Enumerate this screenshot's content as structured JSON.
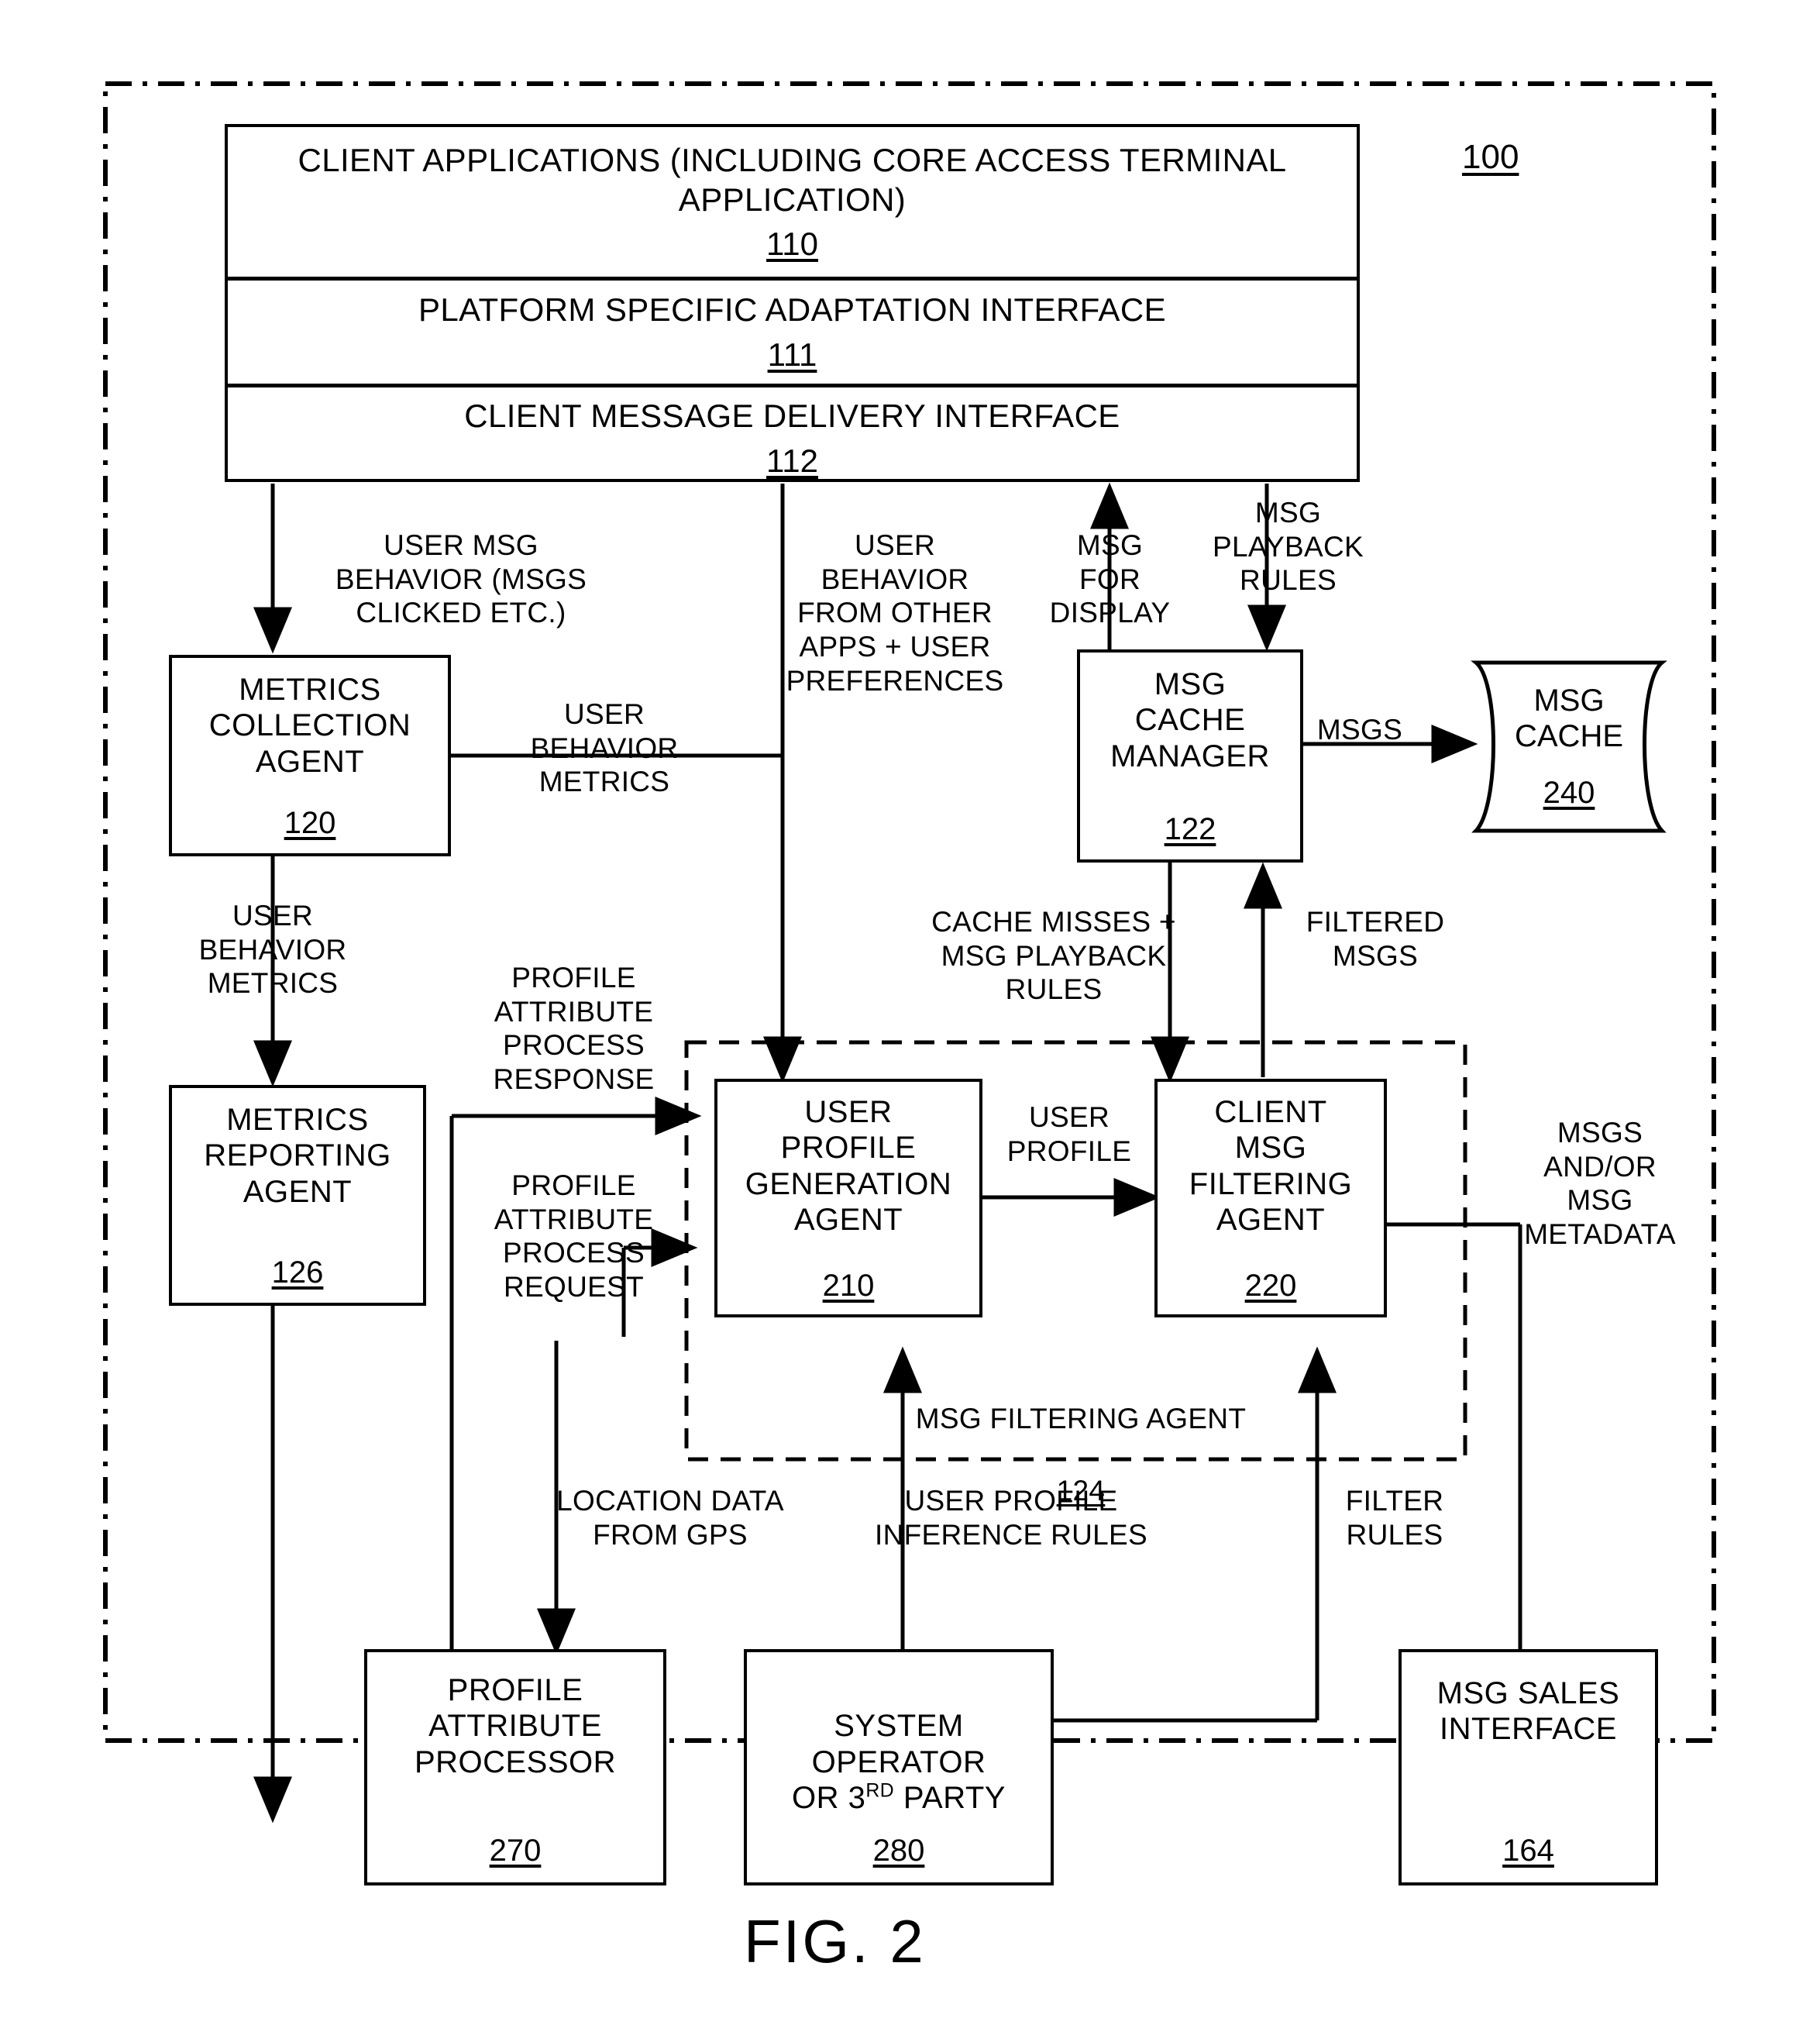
{
  "figure": {
    "caption": "FIG. 2",
    "system_ref": "100"
  },
  "client_stack": {
    "segments": [
      {
        "title": "CLIENT APPLICATIONS (INCLUDING CORE ACCESS TERMINAL\nAPPLICATION)",
        "ref": "110"
      },
      {
        "title": "PLATFORM SPECIFIC ADAPTATION INTERFACE",
        "ref": "111"
      },
      {
        "title": "CLIENT MESSAGE DELIVERY INTERFACE",
        "ref": "112"
      }
    ]
  },
  "boxes": {
    "metrics_collection_agent": {
      "title": "METRICS\nCOLLECTION\nAGENT",
      "ref": "120"
    },
    "metrics_reporting_agent": {
      "title": "METRICS\nREPORTING\nAGENT",
      "ref": "126"
    },
    "msg_cache_manager": {
      "title": "MSG\nCACHE\nMANAGER",
      "ref": "122"
    },
    "msg_cache": {
      "title": "MSG\nCACHE",
      "ref": "240"
    },
    "user_profile_generation_agent": {
      "title": "USER\nPROFILE\nGENERATION\nAGENT",
      "ref": "210"
    },
    "client_msg_filtering_agent": {
      "title": "CLIENT\nMSG\nFILTERING\nAGENT",
      "ref": "220"
    },
    "profile_attribute_processor": {
      "title": "PROFILE\nATTRIBUTE\nPROCESSOR",
      "ref": "270"
    },
    "system_operator": {
      "title_pre": "SYSTEM\nOPERATOR\nOR 3",
      "title_sup": "RD",
      "title_post": " PARTY",
      "ref": "280"
    },
    "msg_sales_interface": {
      "title": "MSG SALES\nINTERFACE",
      "ref": "164"
    }
  },
  "groups": {
    "msg_filtering_agent": {
      "title": "MSG FILTERING AGENT",
      "ref": "124"
    }
  },
  "edge_labels": {
    "user_msg_behavior": "USER MSG\nBEHAVIOR (MSGS\nCLICKED ETC.)",
    "user_behavior_other_apps": "USER\nBEHAVIOR\nFROM OTHER\nAPPS + USER\nPREFERENCES",
    "msg_for_display": "MSG\nFOR\nDISPLAY",
    "msg_playback_rules": "MSG\nPLAYBACK\nRULES",
    "user_behavior_metrics_right": "USER\nBEHAVIOR\nMETRICS",
    "msgs": "MSGS",
    "user_behavior_metrics_left": "USER\nBEHAVIOR\nMETRICS",
    "profile_attribute_process_response": "PROFILE\nATTRIBUTE\nPROCESS\nRESPONSE",
    "profile_attribute_process_request": "PROFILE\nATTRIBUTE\nPROCESS\nREQUEST",
    "cache_misses": "CACHE MISSES +\nMSG PLAYBACK\nRULES",
    "filtered_msgs": "FILTERED\nMSGS",
    "user_profile": "USER\nPROFILE",
    "msgs_and_or_metadata": "MSGS\nAND/OR\nMSG\nMETADATA",
    "location_data_gps": "LOCATION DATA\nFROM GPS",
    "user_profile_inference_rules": "USER PROFILE\nINFERENCE RULES",
    "filter_rules": "FILTER\nRULES"
  }
}
